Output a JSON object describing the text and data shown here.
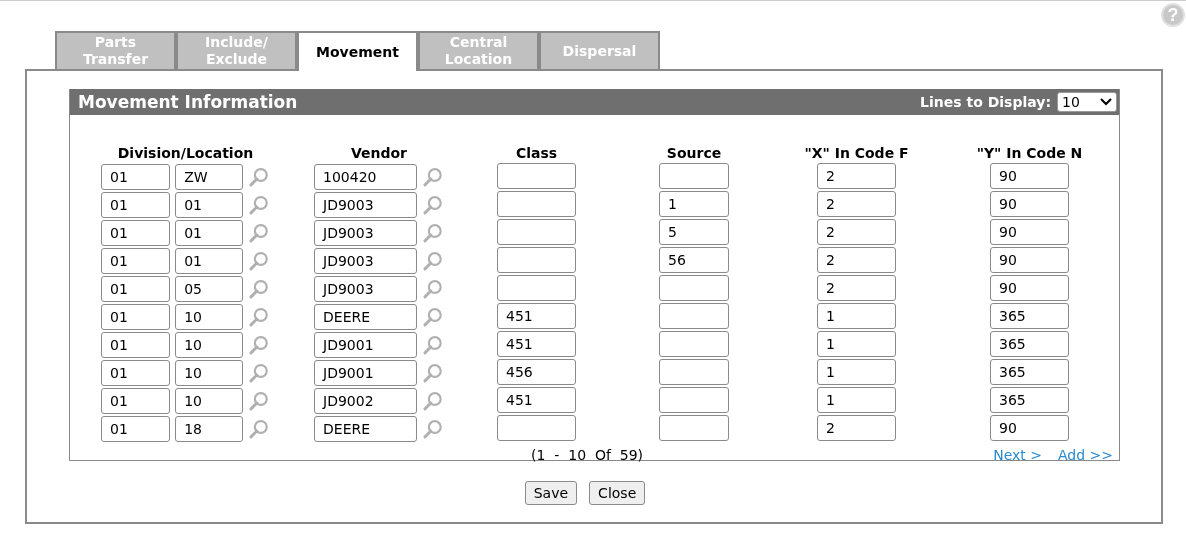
{
  "help_button": {
    "label": "?"
  },
  "tabs": [
    {
      "label": "Parts Transfer",
      "selected": false
    },
    {
      "label": "Include/ Exclude",
      "selected": false
    },
    {
      "label": "Movement",
      "selected": true
    },
    {
      "label": "Central Location",
      "selected": false
    },
    {
      "label": "Dispersal",
      "selected": false
    }
  ],
  "section": {
    "title": "Movement Information",
    "lines_label": "Lines to Display:",
    "lines_value": "10"
  },
  "columns": [
    "Division/Location",
    "Vendor",
    "Class",
    "Source",
    "\"X\" In Code F",
    "\"Y\" In Code N"
  ],
  "rows": [
    {
      "division": "01",
      "location": "ZW",
      "vendor": "100420",
      "class": "",
      "source": "",
      "x_code": "2",
      "y_code": "90"
    },
    {
      "division": "01",
      "location": "01",
      "vendor": "JD9003",
      "class": "",
      "source": "1",
      "x_code": "2",
      "y_code": "90"
    },
    {
      "division": "01",
      "location": "01",
      "vendor": "JD9003",
      "class": "",
      "source": "5",
      "x_code": "2",
      "y_code": "90"
    },
    {
      "division": "01",
      "location": "01",
      "vendor": "JD9003",
      "class": "",
      "source": "56",
      "x_code": "2",
      "y_code": "90"
    },
    {
      "division": "01",
      "location": "05",
      "vendor": "JD9003",
      "class": "",
      "source": "",
      "x_code": "2",
      "y_code": "90"
    },
    {
      "division": "01",
      "location": "10",
      "vendor": "DEERE",
      "class": "451",
      "source": "",
      "x_code": "1",
      "y_code": "365"
    },
    {
      "division": "01",
      "location": "10",
      "vendor": "JD9001",
      "class": "451",
      "source": "",
      "x_code": "1",
      "y_code": "365"
    },
    {
      "division": "01",
      "location": "10",
      "vendor": "JD9001",
      "class": "456",
      "source": "",
      "x_code": "1",
      "y_code": "365"
    },
    {
      "division": "01",
      "location": "10",
      "vendor": "JD9002",
      "class": "451",
      "source": "",
      "x_code": "1",
      "y_code": "365"
    },
    {
      "division": "01",
      "location": "18",
      "vendor": "DEERE",
      "class": "",
      "source": "",
      "x_code": "2",
      "y_code": "90"
    }
  ],
  "pagination": "(1  -  10  Of  59)",
  "links": [
    "Next >",
    "Add >>"
  ],
  "buttons": [
    "Save",
    "Close"
  ]
}
